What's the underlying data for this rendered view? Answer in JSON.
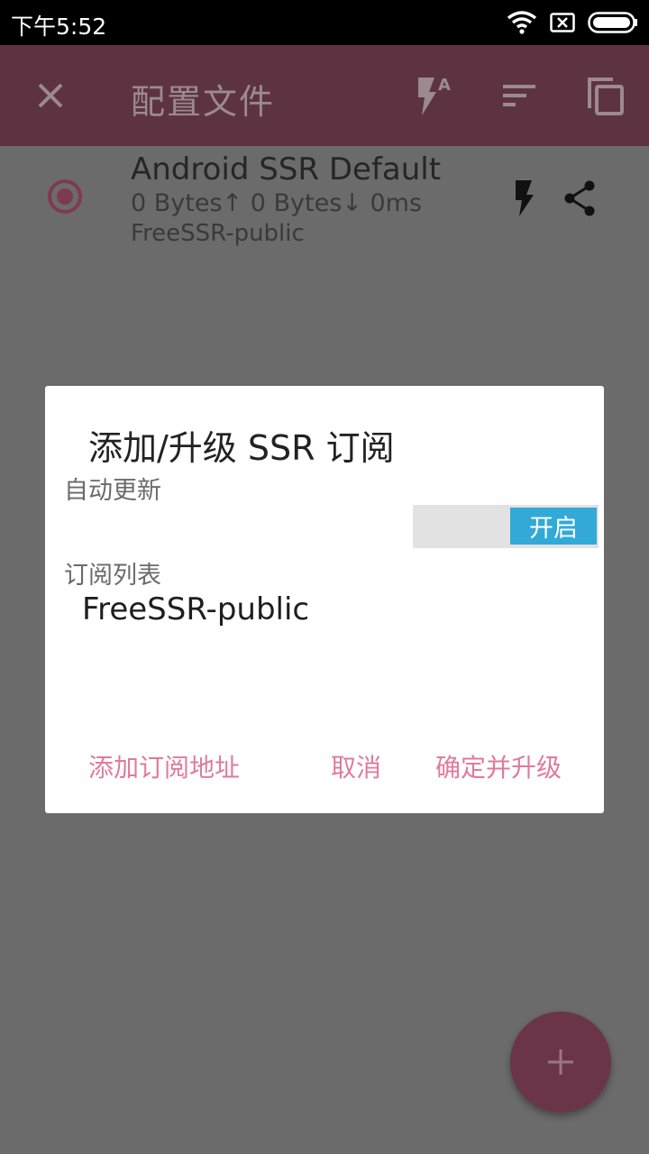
{
  "status_bar": {
    "time": "下午5:52",
    "icons": [
      "wifi-icon",
      "sim-x-icon",
      "battery-icon"
    ]
  },
  "toolbar": {
    "title": "配置文件",
    "icons": [
      "close-icon",
      "flash-auto-icon",
      "sort-icon",
      "copy-icon"
    ]
  },
  "profile": {
    "name": "Android SSR Default",
    "stats": "0 Bytes↑ 0 Bytes↓ 0ms",
    "group": "FreeSSR-public",
    "selected": true
  },
  "dialog": {
    "title": "添加/升级 SSR 订阅",
    "auto_update_label": "自动更新",
    "toggle_label": "开启",
    "toggle_on": true,
    "subscription_list_label": "订阅列表",
    "subscriptions": [
      "FreeSSR-public"
    ],
    "buttons": {
      "add": "添加订阅地址",
      "cancel": "取消",
      "confirm": "确定并升级"
    }
  },
  "fab": {
    "icon": "plus-icon"
  },
  "colors": {
    "toolbar": "#5e3341",
    "scrim_background": "#6b6b6b",
    "accent": "#e07a9e",
    "toggle_on": "#32a9d6",
    "fab": "#6a3548"
  }
}
